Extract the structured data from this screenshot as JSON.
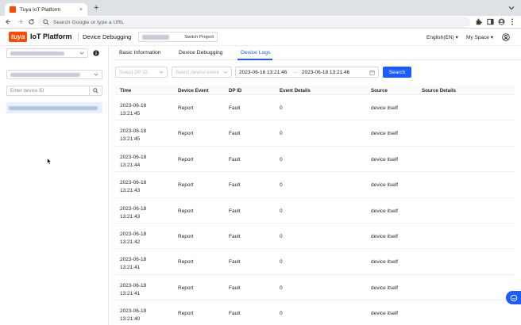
{
  "browser": {
    "tab_title": "Tuya IoT Platform",
    "tab_close": "×",
    "new_tab": "+",
    "omnibox_placeholder": "Search Google or type a URL"
  },
  "header": {
    "logo_text": "tuya",
    "platform_name": "IoT Platform",
    "section_title": "Device Debugging",
    "switch_project_label": "Switch Project",
    "language": "English(EN)",
    "space": "My Space"
  },
  "left": {
    "device_search_placeholder": "Enter device ID"
  },
  "tabs": [
    {
      "label": "Basic Information"
    },
    {
      "label": "Device Debugging"
    },
    {
      "label": "Device Logs"
    }
  ],
  "filters": {
    "dp_id_placeholder": "Select DP ID",
    "event_placeholder": "Select device event",
    "start_time": "2023-06-16 13:21:46",
    "end_time": "2023-06-18 13:21:46",
    "range_arrow": "→",
    "search_label": "Search"
  },
  "table": {
    "headers": [
      "Time",
      "Device Event",
      "DP ID",
      "Event Details",
      "Source",
      "Source Details"
    ],
    "rows": [
      {
        "date": "2023-06-18",
        "time": "13:21:45",
        "event": "Report",
        "dp": "Fault",
        "details": "0",
        "source": "device itself"
      },
      {
        "date": "2023-06-18",
        "time": "13:21:45",
        "event": "Report",
        "dp": "Fault",
        "details": "0",
        "source": "device itself"
      },
      {
        "date": "2023-06-18",
        "time": "13:21:44",
        "event": "Report",
        "dp": "Fault",
        "details": "0",
        "source": "device itself"
      },
      {
        "date": "2023-06-18",
        "time": "13:21:43",
        "event": "Report",
        "dp": "Fault",
        "details": "0",
        "source": "device itself"
      },
      {
        "date": "2023-06-18",
        "time": "13:21:43",
        "event": "Report",
        "dp": "Fault",
        "details": "0",
        "source": "device itself"
      },
      {
        "date": "2023-06-18",
        "time": "13:21:42",
        "event": "Report",
        "dp": "Fault",
        "details": "0",
        "source": "device itself"
      },
      {
        "date": "2023-06-18",
        "time": "13:21:41",
        "event": "Report",
        "dp": "Fault",
        "details": "0",
        "source": "device itself"
      },
      {
        "date": "2023-06-18",
        "time": "13:21:41",
        "event": "Report",
        "dp": "Fault",
        "details": "0",
        "source": "device itself"
      },
      {
        "date": "2023-06-18",
        "time": "13:21:40",
        "event": "Report",
        "dp": "Fault",
        "details": "0",
        "source": "device itself"
      }
    ]
  },
  "colors": {
    "brand": "#ff4800",
    "primary": "#1a5cff",
    "selected_item_bg": "#e6f0ff"
  },
  "icons": [
    "favicon-icon",
    "close-icon",
    "back-icon",
    "forward-icon",
    "reload-icon",
    "search-icon",
    "extensions-icon",
    "sidepanel-icon",
    "profile-icon",
    "more-icon",
    "chevron-down-icon",
    "info-icon",
    "calendar-icon",
    "mouse-cursor-icon",
    "chat-icon"
  ]
}
